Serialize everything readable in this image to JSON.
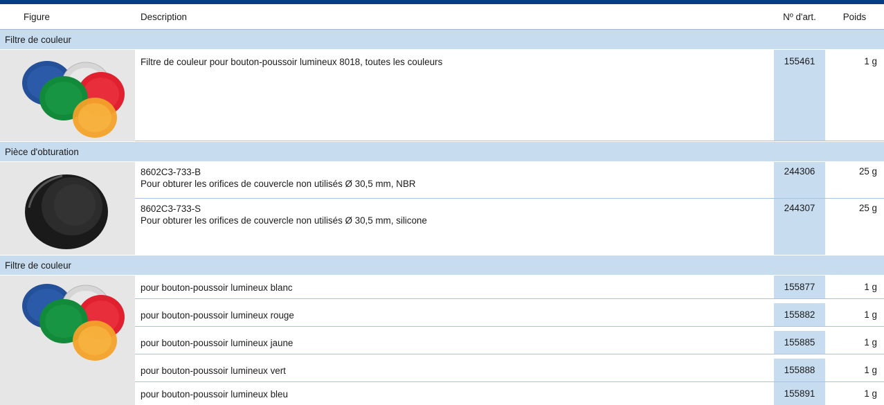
{
  "header": {
    "figure": "Figure",
    "description": "Description",
    "art_no": "Nº d'art.",
    "weight": "Poids"
  },
  "sections": [
    {
      "title": "Filtre de couleur",
      "figure_icon": "color-filter-caps-image",
      "rows": [
        {
          "description": "Filtre de couleur pour bouton-poussoir lumineux 8018, toutes les couleurs",
          "art_no": "155461",
          "weight": "1 g"
        }
      ]
    },
    {
      "title": "Pièce d'obturation",
      "figure_icon": "blanking-plug-image",
      "rows": [
        {
          "line1": "8602C3-733-B",
          "line2": "Pour obturer les orifices de couvercle non utilisés Ø 30,5 mm, NBR",
          "art_no": "244306",
          "weight": "25 g"
        },
        {
          "line1": "8602C3-733-S",
          "line2": "Pour obturer les orifices de couvercle non utilisés Ø 30,5 mm, silicone",
          "art_no": "244307",
          "weight": "25 g"
        }
      ]
    },
    {
      "title": "Filtre de couleur",
      "figure_icon": "color-filter-caps-image",
      "rows": [
        {
          "description": "pour bouton-poussoir lumineux blanc",
          "art_no": "155877",
          "weight": "1 g"
        },
        {
          "description": "pour bouton-poussoir lumineux rouge",
          "art_no": "155882",
          "weight": "1 g"
        },
        {
          "description": "pour bouton-poussoir lumineux jaune",
          "art_no": "155885",
          "weight": "1 g"
        },
        {
          "description": "pour bouton-poussoir lumineux vert",
          "art_no": "155888",
          "weight": "1 g"
        },
        {
          "description": "pour bouton-poussoir lumineux bleu",
          "art_no": "155891",
          "weight": "1 g"
        }
      ]
    }
  ],
  "colors": {
    "header_bar": "#0b3a86",
    "section_band": "#c8dcf0",
    "figure_bg": "#e6e6e6"
  }
}
